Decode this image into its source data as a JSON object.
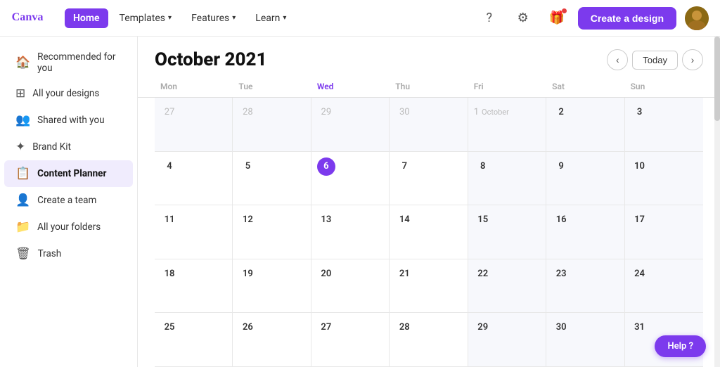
{
  "topnav": {
    "home_label": "Home",
    "templates_label": "Templates",
    "features_label": "Features",
    "learn_label": "Learn",
    "create_label": "Create a design",
    "help_label": "Help ?"
  },
  "sidebar": {
    "items": [
      {
        "id": "recommended",
        "label": "Recommended for you",
        "icon": "🏠"
      },
      {
        "id": "all-designs",
        "label": "All your designs",
        "icon": "⊞"
      },
      {
        "id": "shared",
        "label": "Shared with you",
        "icon": "👥"
      },
      {
        "id": "brand",
        "label": "Brand Kit",
        "icon": "✦"
      },
      {
        "id": "content-planner",
        "label": "Content Planner",
        "icon": "📋"
      },
      {
        "id": "create-team",
        "label": "Create a team",
        "icon": "👤+"
      },
      {
        "id": "folders",
        "label": "All your folders",
        "icon": "📁"
      },
      {
        "id": "trash",
        "label": "Trash",
        "icon": "🗑"
      }
    ]
  },
  "calendar": {
    "title": "October 2021",
    "today_label": "Today",
    "day_headers": [
      "Mon",
      "Tue",
      "Wed",
      "Thu",
      "Fri",
      "Sat",
      "Sun"
    ],
    "today_date": 6,
    "weeks": [
      [
        {
          "date": "27",
          "other": true
        },
        {
          "date": "28",
          "other": true
        },
        {
          "date": "29",
          "other": true
        },
        {
          "date": "30",
          "other": true
        },
        {
          "date": "1",
          "october": true,
          "label": "October"
        },
        {
          "date": "2"
        },
        {
          "date": "3"
        }
      ],
      [
        {
          "date": "4"
        },
        {
          "date": "5"
        },
        {
          "date": "6",
          "today": true
        },
        {
          "date": "7"
        },
        {
          "date": "8"
        },
        {
          "date": "9"
        },
        {
          "date": "10"
        }
      ],
      [
        {
          "date": "11"
        },
        {
          "date": "12"
        },
        {
          "date": "13"
        },
        {
          "date": "14"
        },
        {
          "date": "15"
        },
        {
          "date": "16"
        },
        {
          "date": "17"
        }
      ],
      [
        {
          "date": "18"
        },
        {
          "date": "19"
        },
        {
          "date": "20"
        },
        {
          "date": "21"
        },
        {
          "date": "22"
        },
        {
          "date": "23"
        },
        {
          "date": "24"
        }
      ],
      [
        {
          "date": "25"
        },
        {
          "date": "26"
        },
        {
          "date": "27"
        },
        {
          "date": "28"
        },
        {
          "date": "29"
        },
        {
          "date": "30"
        },
        {
          "date": "31"
        }
      ]
    ]
  }
}
